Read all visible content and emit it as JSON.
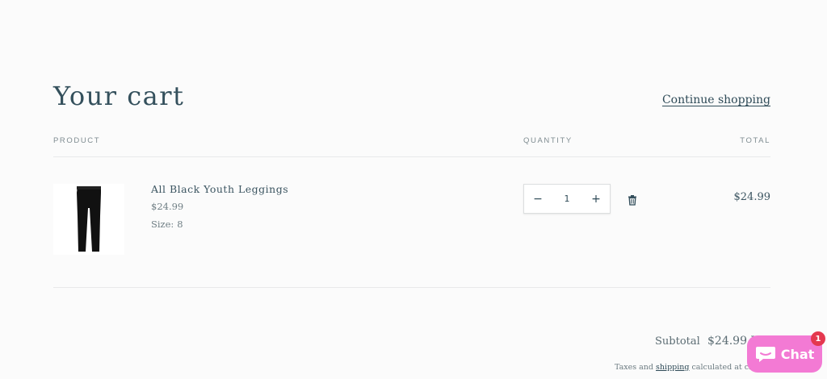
{
  "page": {
    "title": "Your cart",
    "continue_link": "Continue shopping"
  },
  "table": {
    "headers": {
      "product": "PRODUCT",
      "quantity": "QUANTITY",
      "total": "TOTAL"
    }
  },
  "items": [
    {
      "name": "All Black Youth Leggings",
      "price": "$24.99",
      "option_label": "Size:",
      "option_value": "8",
      "quantity": "1",
      "line_total": "$24.99",
      "decrease_symbol": "−",
      "increase_symbol": "+",
      "image_icon": "black-leggings-image",
      "remove_icon": "trash-icon"
    }
  ],
  "summary": {
    "subtotal_label": "Subtotal",
    "subtotal_value": "$24.99 U",
    "tax_prefix": "Taxes and ",
    "tax_link": "shipping",
    "tax_suffix": " calculated at che"
  },
  "chat": {
    "label": "Chat",
    "badge": "1",
    "icon": "chat-bubble-icon",
    "color": "#f37ad4",
    "badge_color": "#e4384f"
  }
}
